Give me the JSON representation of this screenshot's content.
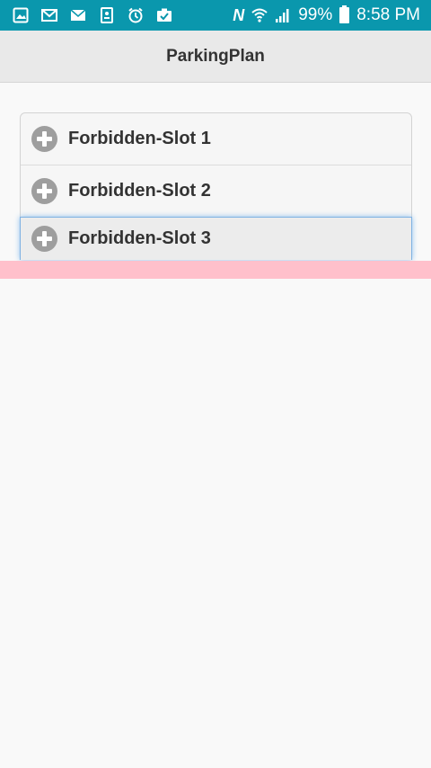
{
  "status_bar": {
    "left_icons": [
      "gallery-icon",
      "gmail-icon",
      "email-icon",
      "contact-card-icon",
      "alarm-icon",
      "clipboard-check-icon"
    ],
    "nfc_label": "N",
    "battery_text": "99%",
    "time": "8:58 PM"
  },
  "header": {
    "title": "ParkingPlan"
  },
  "list": {
    "items": [
      {
        "label": "Forbidden-Slot 1"
      },
      {
        "label": "Forbidden-Slot 2"
      },
      {
        "label": "Forbidden-Slot 3"
      }
    ]
  },
  "colors": {
    "status_bar": "#0a97ad",
    "header_bg": "#e9e9e9",
    "pink_bar": "#ffc0cb",
    "icon_gray": "#9e9e9e"
  }
}
